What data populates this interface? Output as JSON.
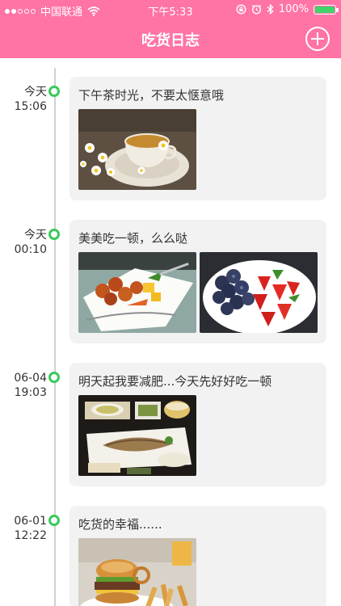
{
  "status_bar": {
    "carrier": "中国联通",
    "time": "下午5:33",
    "battery_percent": "100%",
    "battery_level": 1.0,
    "icons": [
      "signal-dots-icon",
      "wifi-icon",
      "lock-rotation-icon",
      "alarm-icon",
      "bluetooth-icon",
      "battery-icon"
    ]
  },
  "nav": {
    "title": "吃货日志",
    "add_icon": "plus-circle-icon"
  },
  "colors": {
    "nav_bg": "#ff73a6",
    "node": "#38c95a",
    "card_bg": "#f2f2f2",
    "line": "#d0d0d0"
  },
  "entries": [
    {
      "day": "今天",
      "time": "15:06",
      "text": "下午茶时光，不要太惬意哦",
      "photos": [
        "tea-cup-photo"
      ]
    },
    {
      "day": "今天",
      "time": "00:10",
      "text": "美美吃一顿，么么哒",
      "photos": [
        "sweet-sour-pork-photo",
        "berries-bowl-photo"
      ]
    },
    {
      "day": "06-04",
      "time": "19:03",
      "text": "明天起我要减肥...今天先好好吃一顿",
      "photos": [
        "fish-set-meal-photo"
      ]
    },
    {
      "day": "06-01",
      "time": "12:22",
      "text": "吃货的幸福......",
      "photos": [
        "burger-fries-photo"
      ]
    }
  ]
}
